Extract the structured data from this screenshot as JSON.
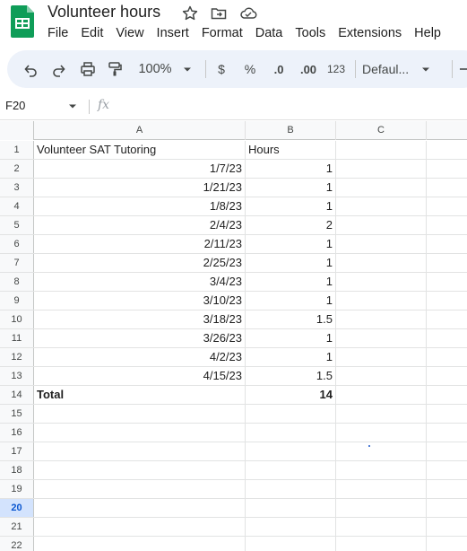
{
  "app": {
    "doc_title": "Volunteer hours",
    "icons": [
      "sheets-logo-icon",
      "star-icon",
      "move-folder-icon",
      "cloud-status-icon"
    ]
  },
  "menu": [
    "File",
    "Edit",
    "View",
    "Insert",
    "Format",
    "Data",
    "Tools",
    "Extensions",
    "Help"
  ],
  "toolbar": {
    "zoom": "100%",
    "currency": "$",
    "percent": "%",
    "decrease_decimals": ".0",
    "increase_decimals": ".00",
    "number_format": "123",
    "font": "Defaul...",
    "icons": [
      "undo-icon",
      "redo-icon",
      "print-icon",
      "paint-format-icon",
      "dropdown-icon",
      "minus-icon"
    ]
  },
  "formula_bar": {
    "name_box": "F20",
    "fx": "fx",
    "content": ""
  },
  "grid": {
    "columns": [
      "A",
      "B",
      "C"
    ],
    "selected_row": "20",
    "rows": [
      {
        "n": "1",
        "a": "Volunteer SAT Tutoring",
        "b": "Hours",
        "bold": false
      },
      {
        "n": "2",
        "a": "1/7/23",
        "b": "1",
        "bold": false
      },
      {
        "n": "3",
        "a": "1/21/23",
        "b": "1",
        "bold": false
      },
      {
        "n": "4",
        "a": "1/8/23",
        "b": "1",
        "bold": false
      },
      {
        "n": "5",
        "a": "2/4/23",
        "b": "2",
        "bold": false
      },
      {
        "n": "6",
        "a": "2/11/23",
        "b": "1",
        "bold": false
      },
      {
        "n": "7",
        "a": "2/25/23",
        "b": "1",
        "bold": false
      },
      {
        "n": "8",
        "a": "3/4/23",
        "b": "1",
        "bold": false
      },
      {
        "n": "9",
        "a": "3/10/23",
        "b": "1",
        "bold": false
      },
      {
        "n": "10",
        "a": "3/18/23",
        "b": "1.5",
        "bold": false
      },
      {
        "n": "11",
        "a": "3/26/23",
        "b": "1",
        "bold": false
      },
      {
        "n": "12",
        "a": "4/2/23",
        "b": "1",
        "bold": false
      },
      {
        "n": "13",
        "a": "4/15/23",
        "b": "1.5",
        "bold": false
      },
      {
        "n": "14",
        "a": "Total",
        "b": "14",
        "bold": true
      },
      {
        "n": "15",
        "a": "",
        "b": "",
        "bold": false
      },
      {
        "n": "16",
        "a": "",
        "b": "",
        "bold": false
      },
      {
        "n": "17",
        "a": "",
        "b": "",
        "bold": false
      },
      {
        "n": "18",
        "a": "",
        "b": "",
        "bold": false
      },
      {
        "n": "19",
        "a": "",
        "b": "",
        "bold": false
      },
      {
        "n": "20",
        "a": "",
        "b": "",
        "bold": false
      },
      {
        "n": "21",
        "a": "",
        "b": "",
        "bold": false
      },
      {
        "n": "22",
        "a": "",
        "b": "",
        "bold": false
      }
    ]
  },
  "colors": {
    "toolbar_bg": "#edf2fa",
    "selected_row_header": "#d3e3fd",
    "accent": "#0b57d0",
    "sheets_green": "#0f9d58"
  }
}
